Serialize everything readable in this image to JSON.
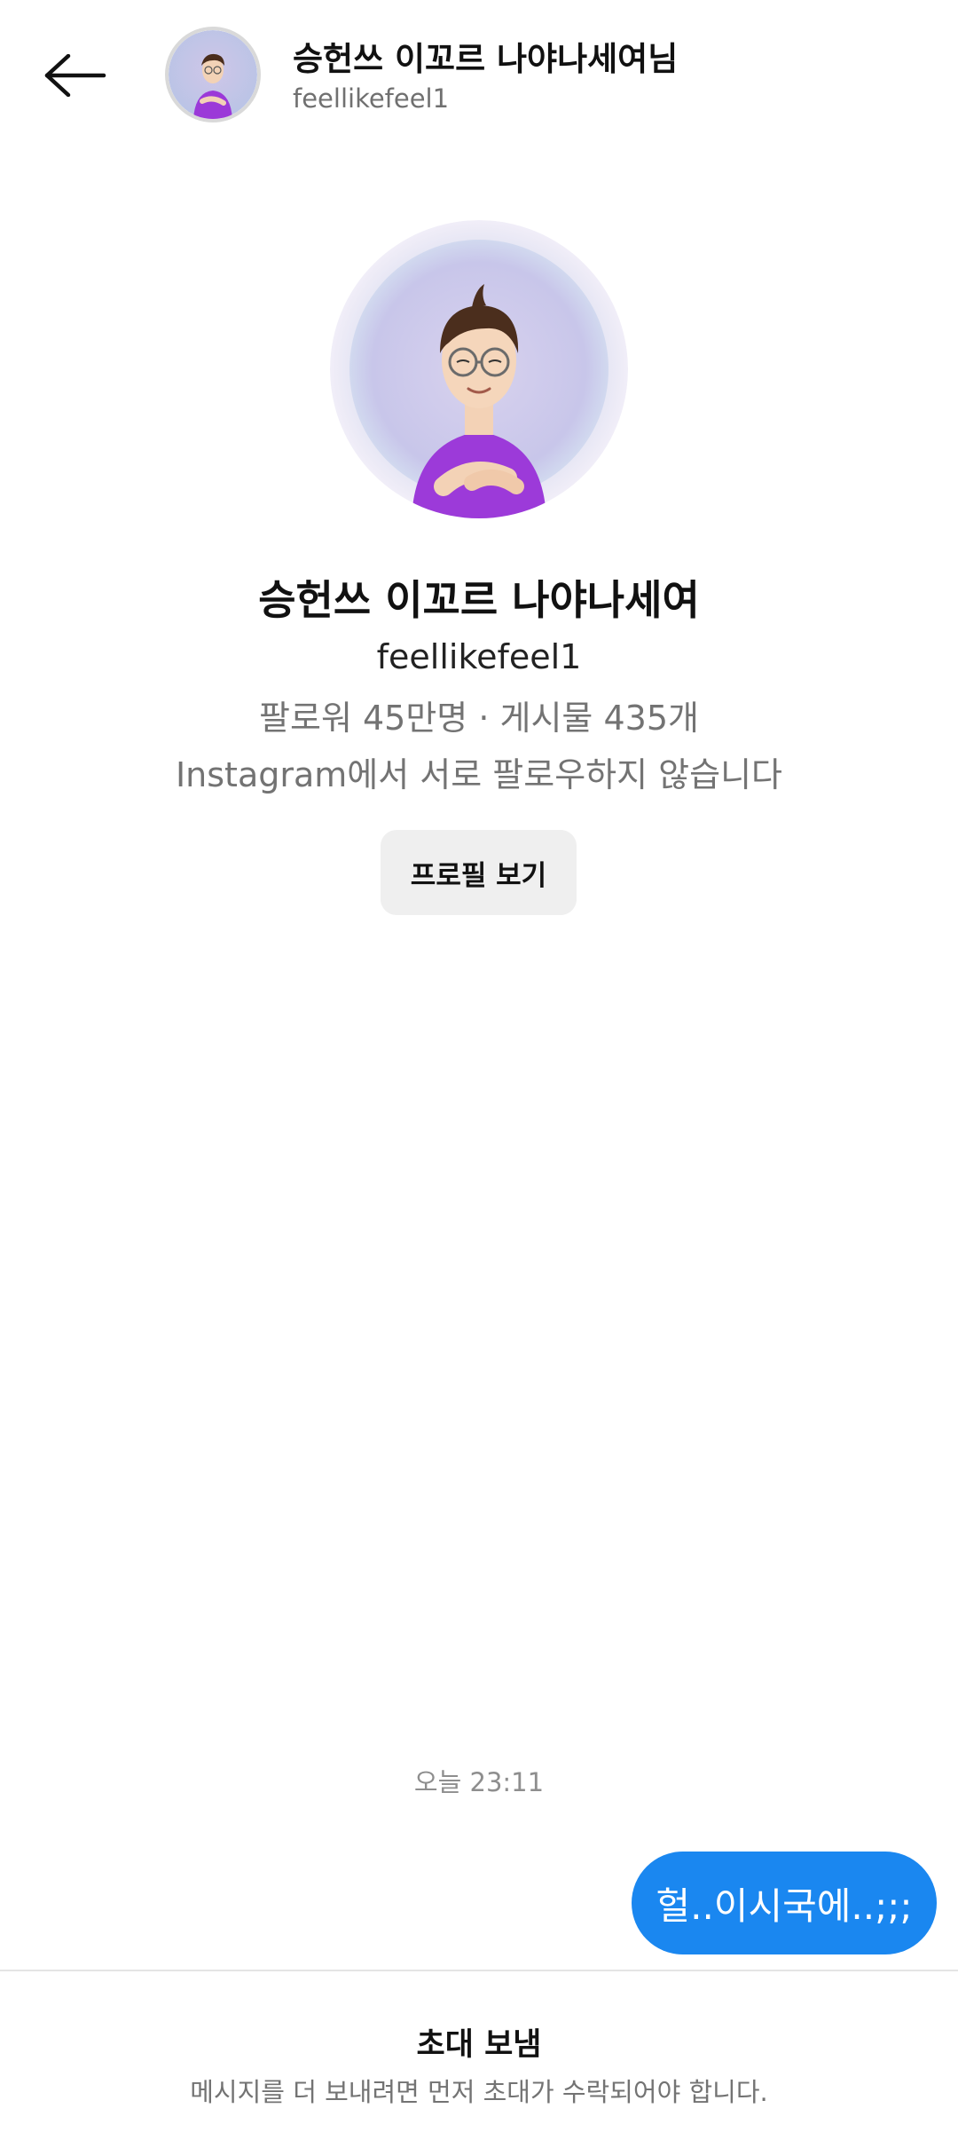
{
  "header": {
    "name": "승헌쓰 이꼬르 나야나세여님",
    "username": "feellikefeel1",
    "back_icon": "arrow-left-icon"
  },
  "profile": {
    "name": "승헌쓰 이꼬르 나야나세여",
    "username": "feellikefeel1",
    "stats": "팔로워 45만명 · 게시물 435개",
    "follow_status": "Instagram에서 서로 팔로우하지 않습니다",
    "view_profile_label": "프로필 보기"
  },
  "messages": {
    "timestamp": "오늘 23:11",
    "items": [
      {
        "text": "헐..이시국에..;;;",
        "sender": "me"
      }
    ]
  },
  "footer": {
    "title": "초대 보냄",
    "description": "메시지를 더 보내려면 먼저 초대가 수락되어야 합니다."
  },
  "colors": {
    "bubble": "#1a87f0",
    "button_bg": "#efefef",
    "secondary_text": "#737373"
  }
}
